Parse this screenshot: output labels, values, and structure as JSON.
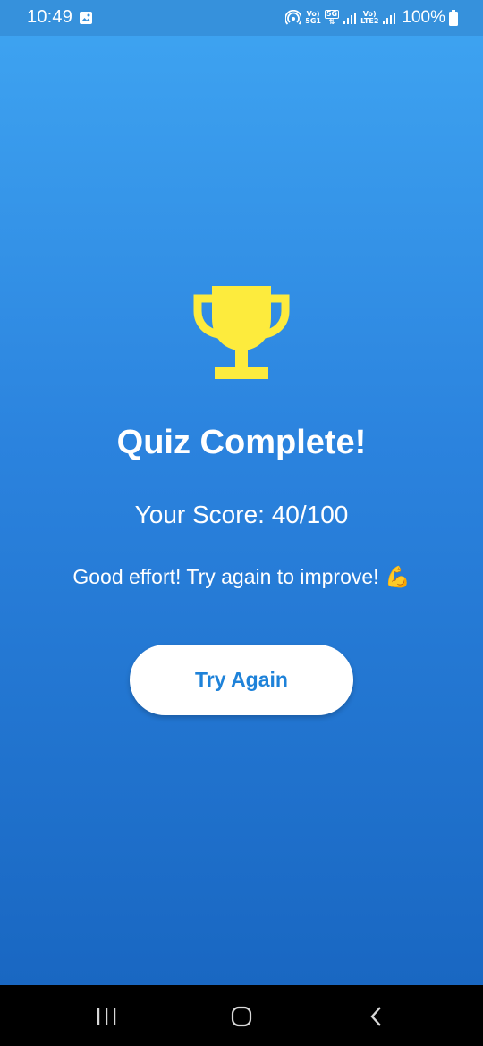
{
  "status_bar": {
    "time": "10:49",
    "sim1_top": "Vo)",
    "sim1_bottom": "5G1",
    "net_type": "5G",
    "sim2_top": "Vo)",
    "sim2_bottom": "LTE2",
    "battery": "100%"
  },
  "result": {
    "title": "Quiz Complete!",
    "score": "Your Score: 40/100",
    "message": "Good effort! Try again to improve! 💪",
    "button_label": "Try Again"
  },
  "icons": {
    "trophy": "trophy-icon",
    "recents": "recents-icon",
    "home": "home-icon",
    "back": "back-icon"
  },
  "colors": {
    "gradient_top": "#3fa5f2",
    "gradient_bottom": "#1967c2",
    "trophy": "#fdeb3d",
    "button_text": "#1e82d9"
  }
}
